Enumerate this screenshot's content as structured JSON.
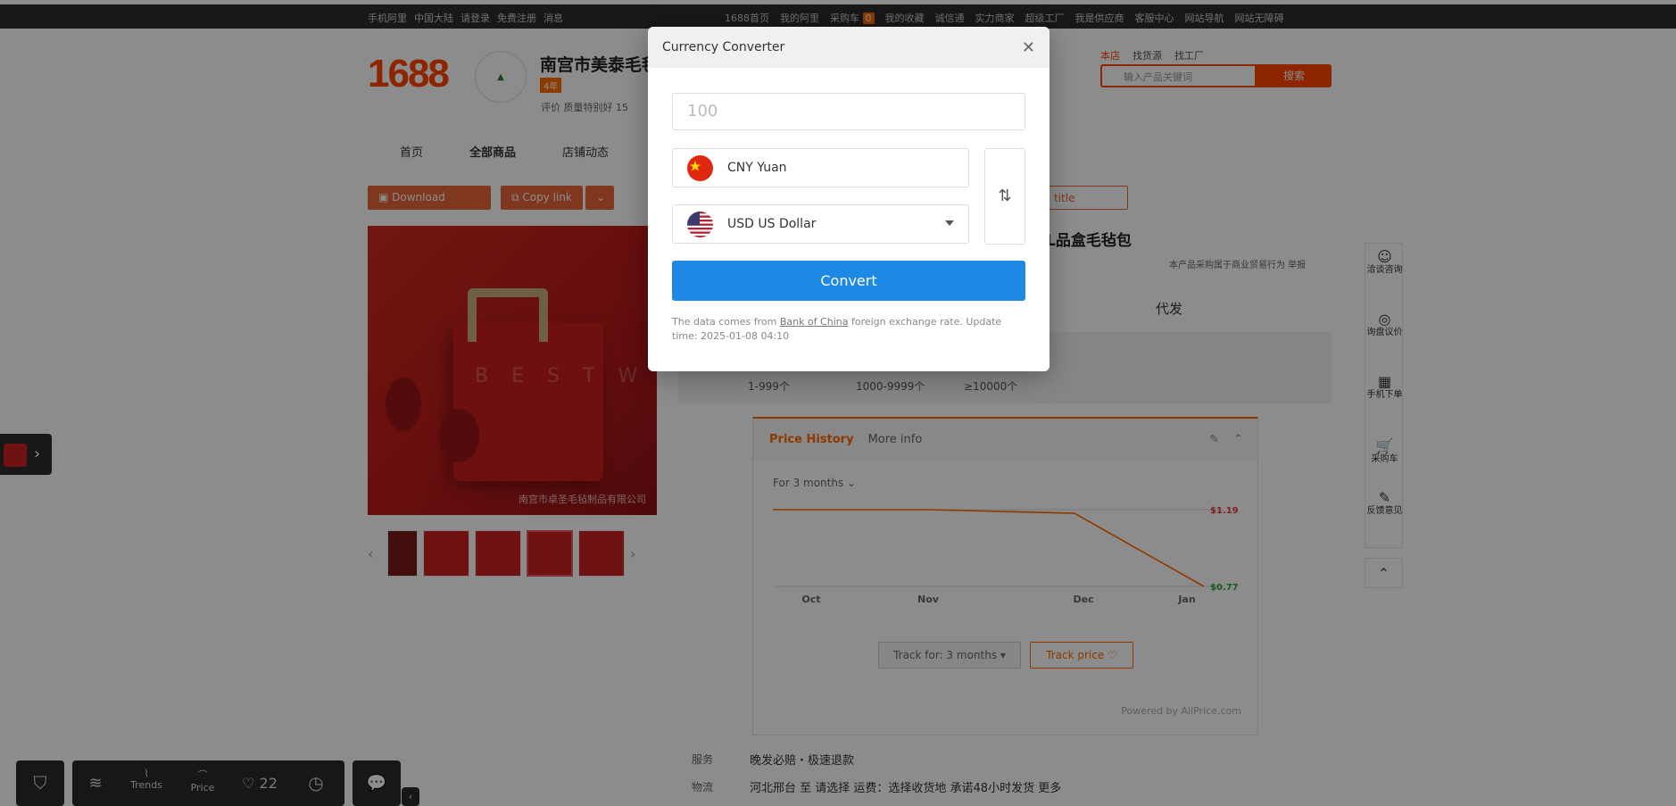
{
  "topbar": {
    "left": [
      "手机阿里",
      "中国大陆",
      "请登录",
      "免费注册",
      "消息"
    ],
    "right": [
      "1688首页",
      "我的阿里",
      "采购车",
      "我的收藏",
      "诚信通",
      "实力商家",
      "超级工厂",
      "我是供应商",
      "客服中心",
      "网站导航",
      "网站无障碍"
    ],
    "cart_count": "0"
  },
  "header": {
    "logo": "1688",
    "shop_name": "南宫市美泰毛毡",
    "shop_badge": "4年",
    "shop_rating": "评价  质量特别好 15",
    "search_tabs": [
      "本店",
      "找货源",
      "找工厂"
    ],
    "search_placeholder": "输入产品关键词",
    "search_button": "搜索"
  },
  "nav": [
    "首页",
    "全部商品",
    "店铺动态"
  ],
  "actions": {
    "download_image": "Download image",
    "copy_link": "Copy link",
    "title": "title"
  },
  "product": {
    "title_fragment": "L品盒毛毡包",
    "note": "本产品采购属于商业贸易行为    举报",
    "daifa": "代发",
    "tiers": [
      "1-999个",
      "1000-9999个",
      "≥10000个"
    ],
    "watermark": "南宫市卓圣毛毡制品有限公司",
    "thumb_count": 5
  },
  "price_history": {
    "tab_active": "Price History",
    "tab_other": "More info",
    "range": "For 3 months",
    "track_for": "Track for: 3 months",
    "track_price": "Track price",
    "powered": "Powered by AliPrice.com",
    "high_label": "$1.19",
    "low_label": "$0.77",
    "colors": {
      "line": "#ff6a00",
      "high": "#e53935",
      "low": "#2e9e3e"
    }
  },
  "chart_data": {
    "type": "line",
    "x": [
      "Oct",
      "Nov",
      "Dec",
      "Jan"
    ],
    "series": [
      {
        "values": [
          1.19,
          1.19,
          1.17,
          0.77
        ]
      }
    ],
    "ylim": [
      0.77,
      1.19
    ],
    "xlabel": "",
    "ylabel": "",
    "grid": false
  },
  "service": {
    "label1": "服务",
    "value1": "晚发必赔・极速退款",
    "label2": "物流",
    "value2": "河北邢台 至 请选择    运费：选择收货地    承诺48小时发货  更多"
  },
  "right_toolbar": [
    {
      "icon": "chat-icon",
      "label": "洽谈咨询"
    },
    {
      "icon": "quote-icon",
      "label": "询盘议价"
    },
    {
      "icon": "qr-icon",
      "label": "手机下单"
    },
    {
      "icon": "cart-icon",
      "label": "采购车"
    },
    {
      "icon": "feedback-icon",
      "label": "反馈意见"
    }
  ],
  "bottom_bar": {
    "trends": "Trends",
    "price": "Price",
    "likes": "22"
  },
  "modal": {
    "title": "Currency Converter",
    "amount_placeholder": "100",
    "from_currency": "CNY Yuan",
    "to_currency": "USD US Dollar",
    "convert_label": "Convert",
    "source_prefix": "The data comes from ",
    "source_link": "Bank of China",
    "source_suffix": " foreign exchange rate. Update time: 2025-01-08 04:10"
  }
}
